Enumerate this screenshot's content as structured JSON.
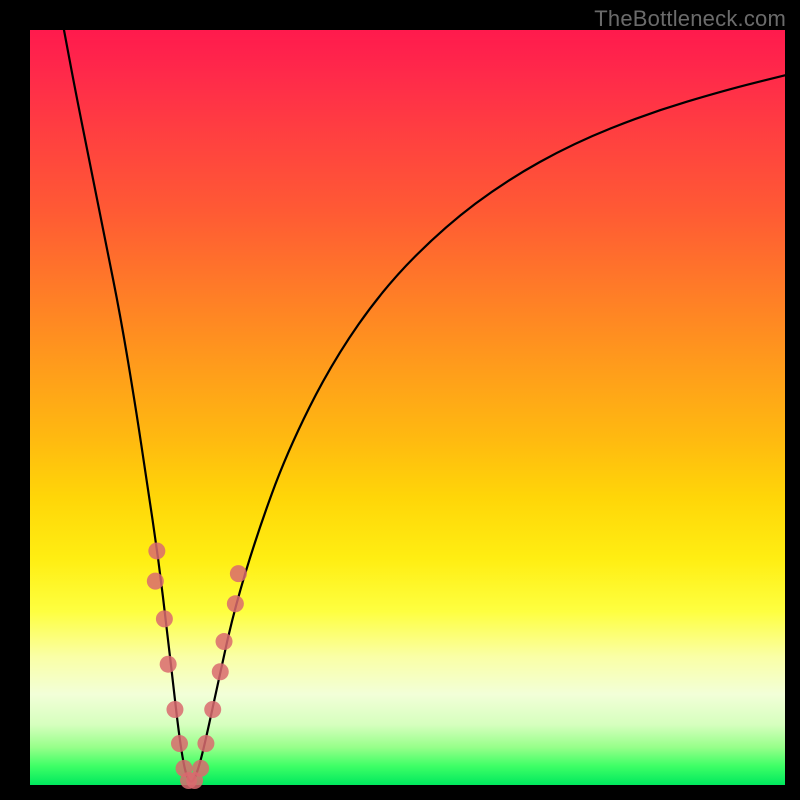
{
  "watermark": "TheBottleneck.com",
  "colors": {
    "curve_stroke": "#000000",
    "marker_fill": "#d96a6f",
    "marker_stroke": "#a94448",
    "frame_bg": "#000000"
  },
  "chart_data": {
    "type": "line",
    "title": "",
    "xlabel": "",
    "ylabel": "",
    "xlim": [
      0,
      100
    ],
    "ylim": [
      0,
      100
    ],
    "grid": false,
    "legend": false,
    "series": [
      {
        "name": "bottleneck-curve",
        "x": [
          4.5,
          6,
          8,
          10,
          12,
          14,
          15.5,
          17,
          18.2,
          19,
          19.7,
          20.3,
          20.8,
          21.3,
          21.8,
          22.5,
          23.5,
          25,
          27,
          30,
          34,
          40,
          47,
          55,
          63,
          72,
          82,
          92,
          100
        ],
        "y": [
          100,
          92,
          82,
          72,
          62,
          50,
          40,
          30,
          20,
          13,
          7,
          3,
          1,
          0.3,
          0.8,
          2.8,
          7,
          14,
          23,
          33,
          44,
          56,
          66,
          74,
          80,
          85,
          89,
          92,
          94
        ]
      }
    ],
    "markers": [
      {
        "x": 16.8,
        "y": 31
      },
      {
        "x": 16.6,
        "y": 27
      },
      {
        "x": 17.8,
        "y": 22
      },
      {
        "x": 18.3,
        "y": 16
      },
      {
        "x": 19.2,
        "y": 10
      },
      {
        "x": 19.8,
        "y": 5.5
      },
      {
        "x": 20.4,
        "y": 2.2
      },
      {
        "x": 21.0,
        "y": 0.6
      },
      {
        "x": 21.8,
        "y": 0.6
      },
      {
        "x": 22.6,
        "y": 2.2
      },
      {
        "x": 23.3,
        "y": 5.5
      },
      {
        "x": 24.2,
        "y": 10
      },
      {
        "x": 25.2,
        "y": 15
      },
      {
        "x": 25.7,
        "y": 19
      },
      {
        "x": 27.2,
        "y": 24
      },
      {
        "x": 27.6,
        "y": 28
      }
    ]
  }
}
